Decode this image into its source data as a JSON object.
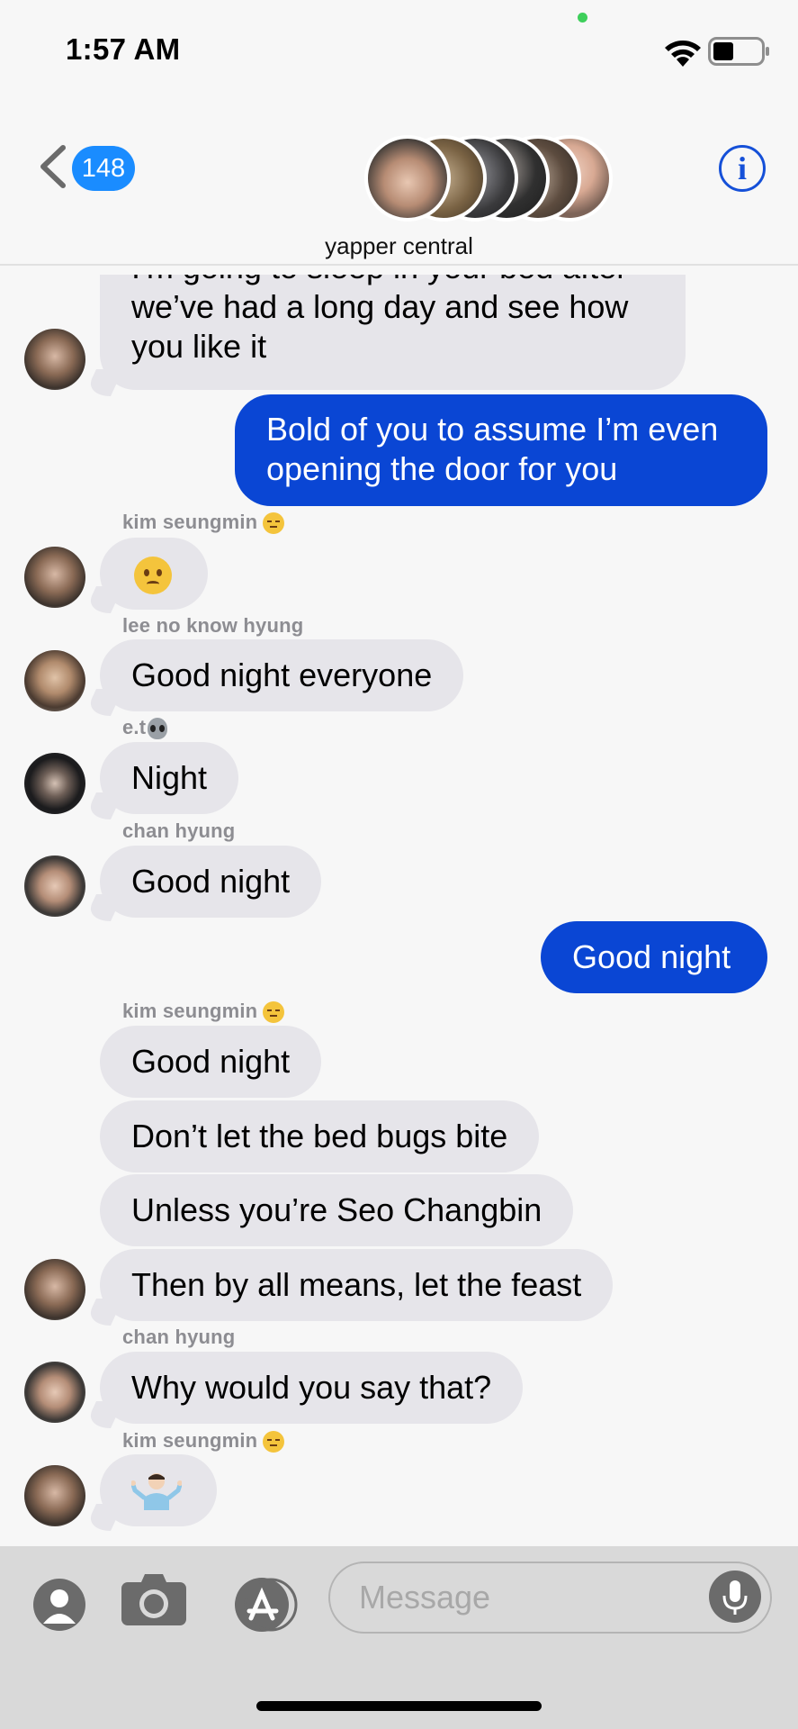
{
  "status_bar": {
    "time": "1:57 AM",
    "battery_level": 0.4
  },
  "header": {
    "back_badge_count": "148",
    "group_name": "yapper central",
    "info_icon": "info-icon",
    "member_avatar_count": 6
  },
  "messages": [
    {
      "side": "incoming",
      "sender": "",
      "lines": [
        "I'm going to sleep in your bed after",
        "we’ve had a long day and see how",
        "you like it"
      ]
    },
    {
      "side": "outgoing",
      "lines": [
        "Bold of you to assume I’m even",
        "opening the door for you"
      ]
    },
    {
      "side": "incoming",
      "sender": "kim seungmin",
      "sender_emoji": "unamused-face",
      "text": "😧"
    },
    {
      "side": "incoming",
      "sender": "lee no know hyung",
      "text": "Good night everyone"
    },
    {
      "side": "incoming",
      "sender": "e.t",
      "sender_emoji": "alien-face",
      "text": "Night"
    },
    {
      "side": "incoming",
      "sender": "chan hyung",
      "text": "Good night"
    },
    {
      "side": "outgoing",
      "text": "Good night"
    },
    {
      "side": "incoming",
      "sender": "kim seungmin",
      "sender_emoji": "unamused-face",
      "text": "Good night"
    },
    {
      "side": "incoming",
      "text": "Don’t let the bed bugs bite"
    },
    {
      "side": "incoming",
      "text": "Unless you’re Seo Changbin"
    },
    {
      "side": "incoming",
      "text": "Then by all means, let the feast"
    },
    {
      "side": "incoming",
      "sender": "chan hyung",
      "text": "Why would you say that?"
    },
    {
      "side": "incoming",
      "sender": "kim seungmin",
      "sender_emoji": "unamused-face",
      "text": "🤷🏻‍♂️"
    }
  ],
  "composer": {
    "placeholder": "Message",
    "icons": [
      "contact-icon",
      "camera-icon",
      "app-store-icon",
      "microphone-icon"
    ]
  }
}
